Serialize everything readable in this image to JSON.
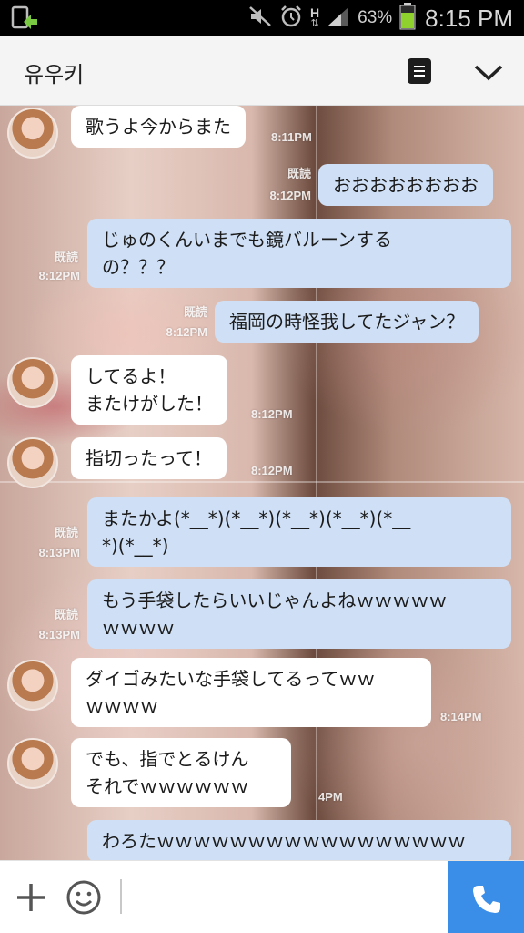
{
  "status_bar": {
    "battery_percent": "63%",
    "time": "8:15 PM",
    "network": "H",
    "icons": [
      "upload-icon",
      "mute-icon",
      "alarm-icon",
      "network-h-icon",
      "signal-icon",
      "battery-icon"
    ]
  },
  "header": {
    "title": "유우키",
    "icons": [
      "menu-icon",
      "chevron-down-icon"
    ]
  },
  "messages": [
    {
      "dir": "in",
      "text": "歌うよ今からまた",
      "time": "8:11PM",
      "read": ""
    },
    {
      "dir": "out",
      "text": "おおおおおおおお",
      "time": "8:12PM",
      "read": "既読"
    },
    {
      "dir": "out",
      "text": "じゅのくんいまでも鏡バルーンする\nの？？？",
      "time": "8:12PM",
      "read": "既読"
    },
    {
      "dir": "out",
      "text": "福岡の時怪我してたジャン？",
      "time": "8:12PM",
      "read": "既読"
    },
    {
      "dir": "in",
      "text": "してるよ！\nまたけがした！",
      "time": "8:12PM",
      "read": ""
    },
    {
      "dir": "in",
      "text": "指切ったって！",
      "time": "8:12PM",
      "read": ""
    },
    {
      "dir": "out",
      "text": "またかよ(*__*)(*__*)(*__*)(*__*)(*__\n*)(*__*)",
      "time": "8:13PM",
      "read": "既読"
    },
    {
      "dir": "out",
      "text": "もう手袋したらいいじゃんよねｗｗｗｗｗ\nｗｗｗｗ",
      "time": "8:13PM",
      "read": "既読"
    },
    {
      "dir": "in",
      "text": "ダイゴみたいな手袋してるってｗｗ\nｗｗｗｗ",
      "time": "8:14PM",
      "read": ""
    },
    {
      "dir": "in",
      "text": "でも、指でとるけん\nそれでｗｗｗｗｗｗ",
      "time": "4PM",
      "read": ""
    },
    {
      "dir": "out",
      "text": "わろたｗｗｗｗｗｗｗｗｗｗｗｗｗｗｗｗｗ",
      "time": "",
      "read": ""
    }
  ],
  "input_bar": {
    "icons": [
      "plus-icon",
      "emoji-icon",
      "phone-icon"
    ]
  },
  "colors": {
    "incoming_bubble": "#ffffff",
    "outgoing_bubble": "#cfe0f6",
    "call_button": "#3b8ee8",
    "header_bg": "#f4f4f4"
  }
}
